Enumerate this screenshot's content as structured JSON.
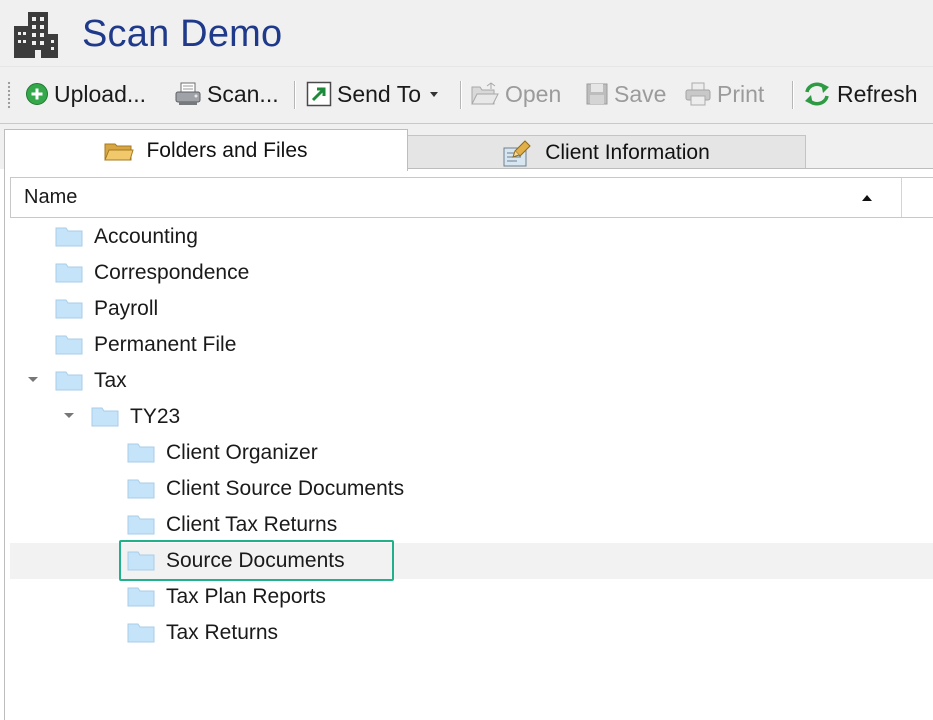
{
  "window": {
    "title": "Scan Demo",
    "title_icon": "building-icon",
    "title_color": "#1f3a8a"
  },
  "toolbar": {
    "upload_label": "Upload...",
    "scan_label": "Scan...",
    "send_to_label": "Send To",
    "open_label": "Open",
    "save_label": "Save",
    "print_label": "Print",
    "refresh_label": "Refresh"
  },
  "tabs": [
    {
      "label": "Folders and Files",
      "icon": "folder-icon",
      "active": true
    },
    {
      "label": "Client Information",
      "icon": "client-info-icon",
      "active": false
    }
  ],
  "tree": {
    "column_header": "Name",
    "sort": "ascending",
    "items": [
      {
        "label": "Accounting",
        "level": 0,
        "expanded": false
      },
      {
        "label": "Correspondence",
        "level": 0,
        "expanded": false
      },
      {
        "label": "Payroll",
        "level": 0,
        "expanded": false
      },
      {
        "label": "Permanent File",
        "level": 0,
        "expanded": false
      },
      {
        "label": "Tax",
        "level": 0,
        "expanded": true
      },
      {
        "label": "TY23",
        "level": 1,
        "expanded": true
      },
      {
        "label": "Client Organizer",
        "level": 2,
        "expanded": false
      },
      {
        "label": "Client Source Documents",
        "level": 2,
        "expanded": false
      },
      {
        "label": "Client Tax Returns",
        "level": 2,
        "expanded": false
      },
      {
        "label": "Source Documents",
        "level": 2,
        "expanded": false,
        "selected": true
      },
      {
        "label": "Tax Plan Reports",
        "level": 2,
        "expanded": false
      },
      {
        "label": "Tax Returns",
        "level": 2,
        "expanded": false
      }
    ]
  },
  "colors": {
    "highlight_border": "#21b08a",
    "folder_fill": "#c5e4fa"
  }
}
